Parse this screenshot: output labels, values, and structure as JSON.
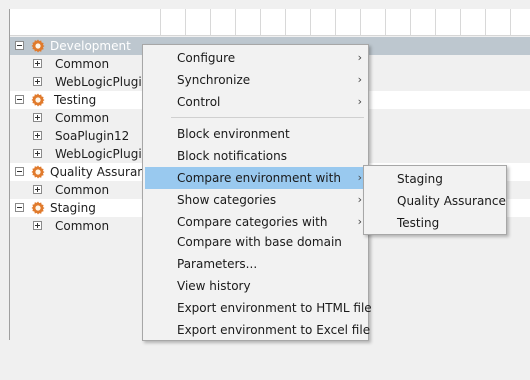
{
  "tree": {
    "environments": [
      {
        "name": "Development",
        "selected": true,
        "plugins": [
          "Common",
          "WebLogicPlugin"
        ]
      },
      {
        "name": "Testing",
        "selected": false,
        "plugins": [
          "Common",
          "SoaPlugin12",
          "WebLogicPlugin"
        ]
      },
      {
        "name": "Quality Assurance",
        "selected": false,
        "plugins": [
          "Common"
        ]
      },
      {
        "name": "Staging",
        "selected": false,
        "plugins": [
          "Common"
        ]
      }
    ]
  },
  "context_menu": {
    "items": [
      {
        "label": "Configure",
        "submenu": true
      },
      {
        "label": "Synchronize",
        "submenu": true
      },
      {
        "label": "Control",
        "submenu": true
      },
      {
        "label": "Block environment",
        "submenu": false
      },
      {
        "label": "Block notifications",
        "submenu": false
      },
      {
        "label": "Compare environment with",
        "submenu": true,
        "highlighted": true
      },
      {
        "label": "Show categories",
        "submenu": true
      },
      {
        "label": "Compare categories with",
        "submenu": true
      },
      {
        "label": "Compare with base domain",
        "submenu": false
      },
      {
        "label": "Parameters...",
        "submenu": false
      },
      {
        "label": "View history",
        "submenu": false
      },
      {
        "label": "Export environment to HTML file",
        "submenu": false
      },
      {
        "label": "Export environment to Excel file",
        "submenu": false
      }
    ],
    "arrow_glyph": "›"
  },
  "compare_submenu": {
    "items": [
      "Staging",
      "Quality Assurance",
      "Testing"
    ]
  },
  "colors": {
    "selected_row": "#bdc7cf",
    "menu_highlight": "#99c9ef",
    "gear_orange": "#e07a2c"
  }
}
